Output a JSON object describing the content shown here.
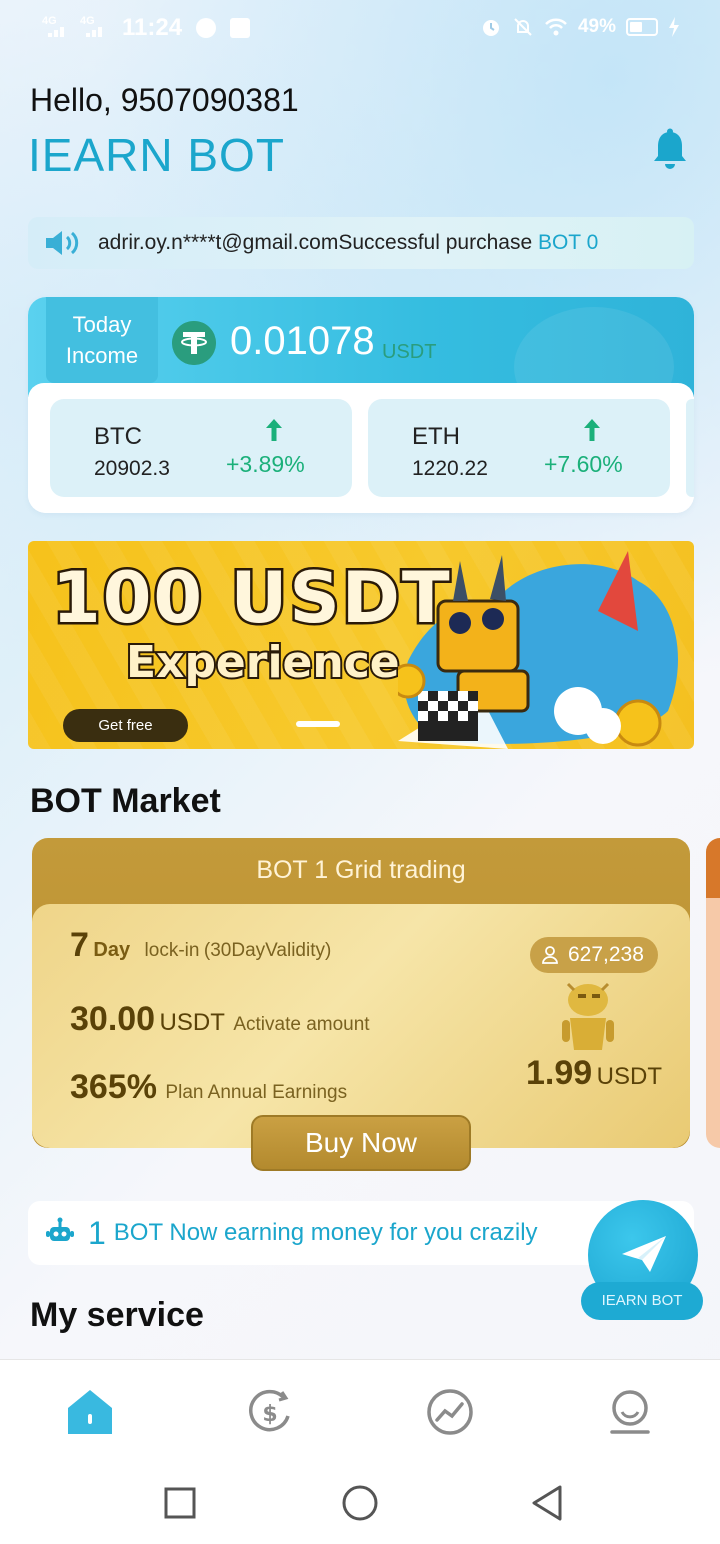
{
  "status_bar": {
    "time": "11:24",
    "network_1": "4G",
    "network_2": "4G",
    "battery": "49%"
  },
  "header": {
    "greeting": "Hello, 9507090381",
    "brand": "IEARN BOT"
  },
  "notice": {
    "text": "adrir.oy.n****t@gmail.comSuccessful purchase ",
    "bot": "BOT 0"
  },
  "income": {
    "label_line1": "Today",
    "label_line2": "Income",
    "amount": "0.01078",
    "unit": "USDT"
  },
  "coins": [
    {
      "name": "BTC",
      "price": "20902.3",
      "change": "+3.89%"
    },
    {
      "name": "ETH",
      "price": "1220.22",
      "change": "+7.60%"
    }
  ],
  "banner": {
    "title": "100 USDT",
    "subtitle": "Experience",
    "button": "Get free"
  },
  "market": {
    "title": "BOT Market",
    "card": {
      "header": "BOT 1   Grid trading",
      "days": "7",
      "day_label": "Day",
      "lockin": "lock-in",
      "validity": "(30DayValidity)",
      "activate_amount": "30.00",
      "activate_unit": "USDT",
      "activate_label": "Activate amount",
      "annual": "365%",
      "annual_label": "Plan Annual Earnings",
      "users": "627,238",
      "price": "1.99",
      "price_unit": "USDT",
      "buy": "Buy Now"
    }
  },
  "earning": {
    "count": "1",
    "text": "BOT Now earning money for you crazily"
  },
  "fab": {
    "label": "IEARN BOT"
  },
  "service": {
    "title": "My service"
  },
  "colors": {
    "accent": "#1ba6cc",
    "gain": "#1bb07a",
    "gold": "#c39a3a",
    "tether": "#2a9d7e"
  }
}
